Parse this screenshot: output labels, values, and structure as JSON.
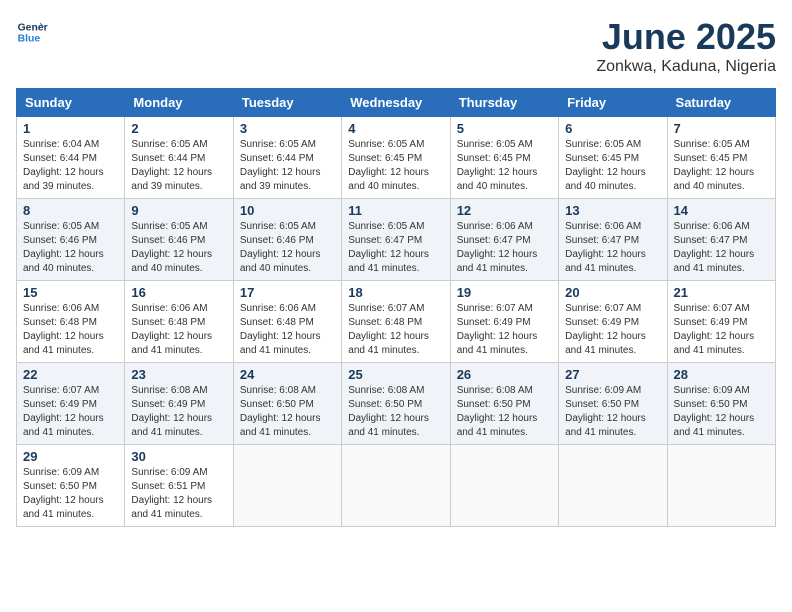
{
  "logo": {
    "line1": "General",
    "line2": "Blue"
  },
  "calendar": {
    "title": "June 2025",
    "subtitle": "Zonkwa, Kaduna, Nigeria",
    "headers": [
      "Sunday",
      "Monday",
      "Tuesday",
      "Wednesday",
      "Thursday",
      "Friday",
      "Saturday"
    ],
    "weeks": [
      [
        {
          "day": "1",
          "info": "Sunrise: 6:04 AM\nSunset: 6:44 PM\nDaylight: 12 hours and 39 minutes."
        },
        {
          "day": "2",
          "info": "Sunrise: 6:05 AM\nSunset: 6:44 PM\nDaylight: 12 hours and 39 minutes."
        },
        {
          "day": "3",
          "info": "Sunrise: 6:05 AM\nSunset: 6:44 PM\nDaylight: 12 hours and 39 minutes."
        },
        {
          "day": "4",
          "info": "Sunrise: 6:05 AM\nSunset: 6:45 PM\nDaylight: 12 hours and 40 minutes."
        },
        {
          "day": "5",
          "info": "Sunrise: 6:05 AM\nSunset: 6:45 PM\nDaylight: 12 hours and 40 minutes."
        },
        {
          "day": "6",
          "info": "Sunrise: 6:05 AM\nSunset: 6:45 PM\nDaylight: 12 hours and 40 minutes."
        },
        {
          "day": "7",
          "info": "Sunrise: 6:05 AM\nSunset: 6:45 PM\nDaylight: 12 hours and 40 minutes."
        }
      ],
      [
        {
          "day": "8",
          "info": "Sunrise: 6:05 AM\nSunset: 6:46 PM\nDaylight: 12 hours and 40 minutes."
        },
        {
          "day": "9",
          "info": "Sunrise: 6:05 AM\nSunset: 6:46 PM\nDaylight: 12 hours and 40 minutes."
        },
        {
          "day": "10",
          "info": "Sunrise: 6:05 AM\nSunset: 6:46 PM\nDaylight: 12 hours and 40 minutes."
        },
        {
          "day": "11",
          "info": "Sunrise: 6:05 AM\nSunset: 6:47 PM\nDaylight: 12 hours and 41 minutes."
        },
        {
          "day": "12",
          "info": "Sunrise: 6:06 AM\nSunset: 6:47 PM\nDaylight: 12 hours and 41 minutes."
        },
        {
          "day": "13",
          "info": "Sunrise: 6:06 AM\nSunset: 6:47 PM\nDaylight: 12 hours and 41 minutes."
        },
        {
          "day": "14",
          "info": "Sunrise: 6:06 AM\nSunset: 6:47 PM\nDaylight: 12 hours and 41 minutes."
        }
      ],
      [
        {
          "day": "15",
          "info": "Sunrise: 6:06 AM\nSunset: 6:48 PM\nDaylight: 12 hours and 41 minutes."
        },
        {
          "day": "16",
          "info": "Sunrise: 6:06 AM\nSunset: 6:48 PM\nDaylight: 12 hours and 41 minutes."
        },
        {
          "day": "17",
          "info": "Sunrise: 6:06 AM\nSunset: 6:48 PM\nDaylight: 12 hours and 41 minutes."
        },
        {
          "day": "18",
          "info": "Sunrise: 6:07 AM\nSunset: 6:48 PM\nDaylight: 12 hours and 41 minutes."
        },
        {
          "day": "19",
          "info": "Sunrise: 6:07 AM\nSunset: 6:49 PM\nDaylight: 12 hours and 41 minutes."
        },
        {
          "day": "20",
          "info": "Sunrise: 6:07 AM\nSunset: 6:49 PM\nDaylight: 12 hours and 41 minutes."
        },
        {
          "day": "21",
          "info": "Sunrise: 6:07 AM\nSunset: 6:49 PM\nDaylight: 12 hours and 41 minutes."
        }
      ],
      [
        {
          "day": "22",
          "info": "Sunrise: 6:07 AM\nSunset: 6:49 PM\nDaylight: 12 hours and 41 minutes."
        },
        {
          "day": "23",
          "info": "Sunrise: 6:08 AM\nSunset: 6:49 PM\nDaylight: 12 hours and 41 minutes."
        },
        {
          "day": "24",
          "info": "Sunrise: 6:08 AM\nSunset: 6:50 PM\nDaylight: 12 hours and 41 minutes."
        },
        {
          "day": "25",
          "info": "Sunrise: 6:08 AM\nSunset: 6:50 PM\nDaylight: 12 hours and 41 minutes."
        },
        {
          "day": "26",
          "info": "Sunrise: 6:08 AM\nSunset: 6:50 PM\nDaylight: 12 hours and 41 minutes."
        },
        {
          "day": "27",
          "info": "Sunrise: 6:09 AM\nSunset: 6:50 PM\nDaylight: 12 hours and 41 minutes."
        },
        {
          "day": "28",
          "info": "Sunrise: 6:09 AM\nSunset: 6:50 PM\nDaylight: 12 hours and 41 minutes."
        }
      ],
      [
        {
          "day": "29",
          "info": "Sunrise: 6:09 AM\nSunset: 6:50 PM\nDaylight: 12 hours and 41 minutes."
        },
        {
          "day": "30",
          "info": "Sunrise: 6:09 AM\nSunset: 6:51 PM\nDaylight: 12 hours and 41 minutes."
        },
        {
          "day": "",
          "info": ""
        },
        {
          "day": "",
          "info": ""
        },
        {
          "day": "",
          "info": ""
        },
        {
          "day": "",
          "info": ""
        },
        {
          "day": "",
          "info": ""
        }
      ]
    ]
  }
}
